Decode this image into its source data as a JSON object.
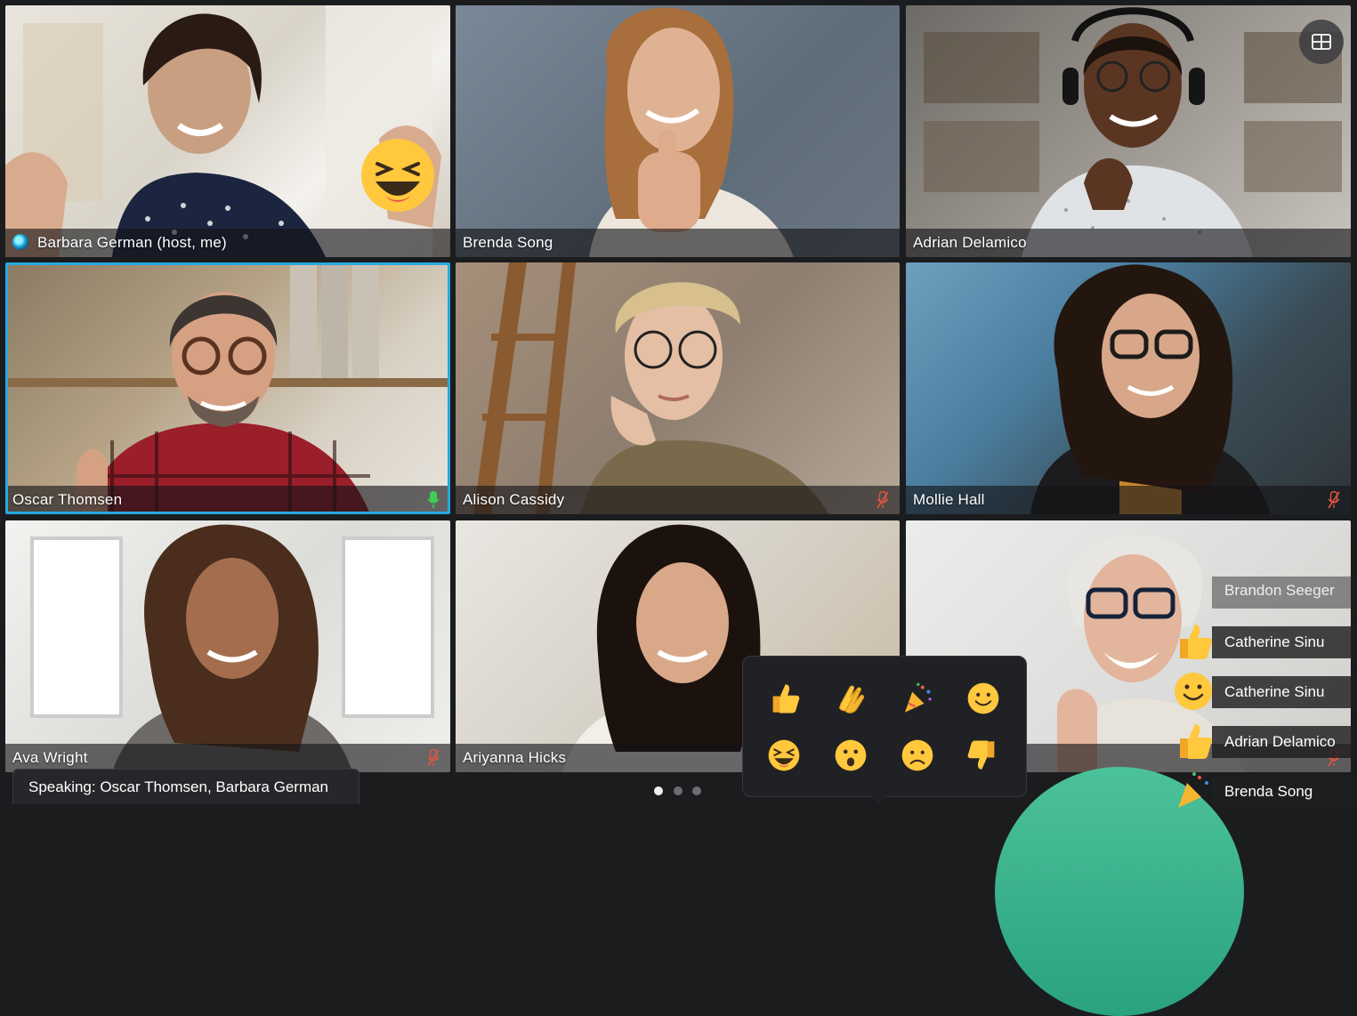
{
  "tiles": [
    {
      "name": "Barbara German (host, me)",
      "mic": "none",
      "host": true
    },
    {
      "name": "Brenda Song",
      "mic": "none"
    },
    {
      "name": "Adrian Delamico",
      "mic": "none"
    },
    {
      "name": "Oscar Thomsen",
      "mic": "speaking",
      "active": true
    },
    {
      "name": "Alison Cassidy",
      "mic": "muted"
    },
    {
      "name": "Mollie Hall",
      "mic": "muted"
    },
    {
      "name": "Ava Wright",
      "mic": "muted"
    },
    {
      "name": "Ariyanna Hicks",
      "mic": "none"
    },
    {
      "name": "",
      "mic": "muted"
    }
  ],
  "speaking": {
    "label": "Speaking: Oscar Thomsen, Barbara German"
  },
  "pagination": {
    "pages": 3,
    "current": 1
  },
  "layout_button": {
    "icon": "grid-layout-icon"
  },
  "reactions": [
    "thumbs-up-icon",
    "clap-icon",
    "party-popper-icon",
    "smile-icon",
    "laugh-icon",
    "surprised-icon",
    "sad-icon",
    "thumbs-down-icon"
  ],
  "reaction_feed": [
    {
      "name": "Brandon Seeger",
      "emoji": "party-popper-icon"
    },
    {
      "name": "Catherine Sinu",
      "emoji": "thumbs-up-icon"
    },
    {
      "name": "Catherine Sinu",
      "emoji": "smile-icon"
    },
    {
      "name": "Adrian Delamico",
      "emoji": "thumbs-up-icon"
    },
    {
      "name": "Brenda Song",
      "emoji": "party-popper-icon"
    }
  ],
  "colors": {
    "active_border": "#27a9df",
    "mic_speaking": "#3ccf5a",
    "mic_muted": "#e0563f",
    "emoji_yellow": "#ffc83d"
  }
}
